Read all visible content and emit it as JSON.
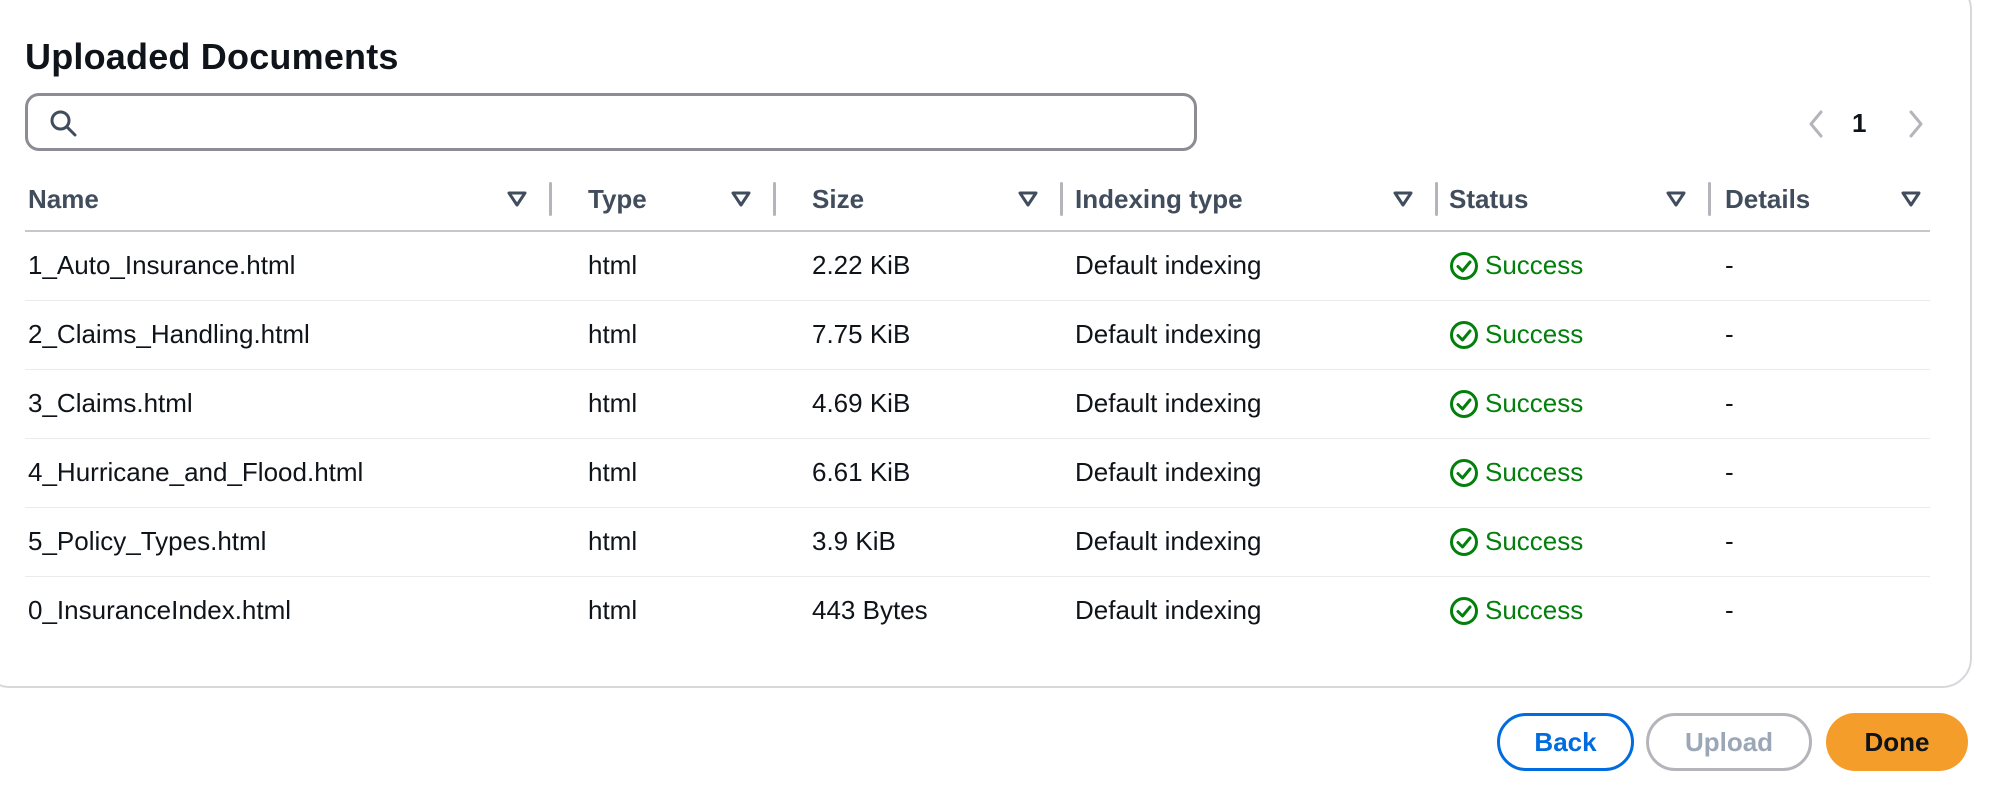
{
  "title": "Uploaded Documents",
  "search": {
    "placeholder": "",
    "value": ""
  },
  "pagination": {
    "current_page": "1"
  },
  "columns": [
    "Name",
    "Type",
    "Size",
    "Indexing type",
    "Status",
    "Details"
  ],
  "rows": [
    {
      "name": "1_Auto_Insurance.html",
      "type": "html",
      "size": "2.22 KiB",
      "indexing_type": "Default indexing",
      "status": "Success",
      "details": "-"
    },
    {
      "name": "2_Claims_Handling.html",
      "type": "html",
      "size": "7.75 KiB",
      "indexing_type": "Default indexing",
      "status": "Success",
      "details": "-"
    },
    {
      "name": "3_Claims.html",
      "type": "html",
      "size": "4.69 KiB",
      "indexing_type": "Default indexing",
      "status": "Success",
      "details": "-"
    },
    {
      "name": "4_Hurricane_and_Flood.html",
      "type": "html",
      "size": "6.61 KiB",
      "indexing_type": "Default indexing",
      "status": "Success",
      "details": "-"
    },
    {
      "name": "5_Policy_Types.html",
      "type": "html",
      "size": "3.9 KiB",
      "indexing_type": "Default indexing",
      "status": "Success",
      "details": "-"
    },
    {
      "name": "0_InsuranceIndex.html",
      "type": "html",
      "size": "443 Bytes",
      "indexing_type": "Default indexing",
      "status": "Success",
      "details": "-"
    }
  ],
  "buttons": {
    "back": "Back",
    "upload": "Upload",
    "done": "Done"
  },
  "colors": {
    "success": "#037f0c",
    "primary": "#006ce0",
    "accent": "#f59d2a",
    "disabled": "#9ba7b6"
  },
  "icons": {
    "search": "search-icon",
    "prev": "chevron-left-icon",
    "next": "chevron-right-icon",
    "sort": "caret-down-icon",
    "status": "check-circle-icon"
  }
}
